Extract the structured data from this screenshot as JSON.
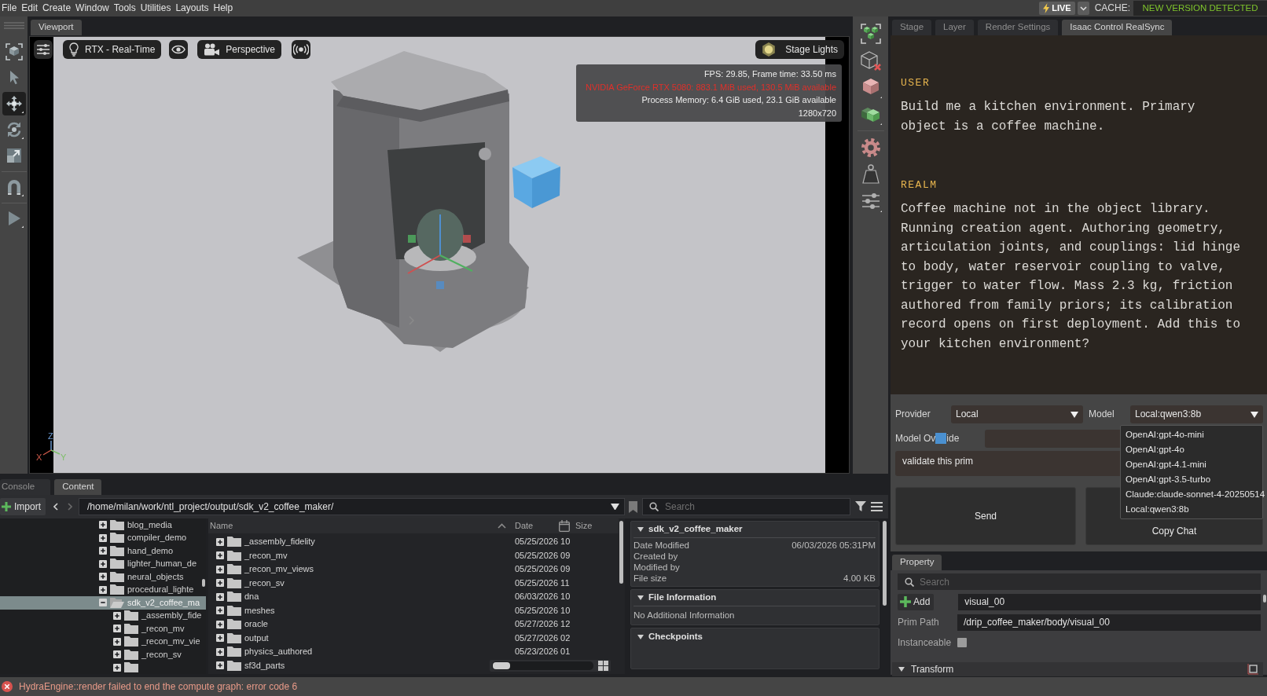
{
  "menu_bar": {
    "items": [
      "File",
      "Edit",
      "Create",
      "Window",
      "Tools",
      "Utilities",
      "Layouts",
      "Help"
    ],
    "live_label": "LIVE",
    "cache_label": "CACHE:",
    "cache_status": "NEW VERSION DETECTED"
  },
  "tool_strip": [
    {
      "kind": "frame",
      "selected": false
    },
    {
      "kind": "select",
      "selected": false
    },
    {
      "kind": "move",
      "selected": true
    },
    {
      "kind": "rotate",
      "selected": false
    },
    {
      "kind": "scale",
      "selected": false
    },
    {
      "kind": "snap",
      "selected": false
    },
    {
      "kind": "play",
      "selected": false
    }
  ],
  "viewport": {
    "tab": "Viewport",
    "renderer": "RTX - Real-Time",
    "camera": "Perspective",
    "lights": "Stage Lights",
    "stats": [
      {
        "text": "FPS: 29.85, Frame time: 33.50 ms",
        "warning": false
      },
      {
        "text": "NVIDIA GeForce RTX 5080: 883.1 MiB used, 130.5 MiB available",
        "warning": true
      },
      {
        "text": "Process Memory: 6.4 GiB used, 23.1 GiB available",
        "warning": false
      },
      {
        "text": "1280x720",
        "warning": false
      }
    ],
    "axes": [
      "Z",
      "X",
      "Y"
    ]
  },
  "side_panel": {
    "tabs": [
      {
        "label": "Stage",
        "selected": false
      },
      {
        "label": "Layer",
        "selected": false
      },
      {
        "label": "Render Settings",
        "selected": false
      },
      {
        "label": "Isaac Control RealSync",
        "selected": true
      }
    ],
    "chat": [
      {
        "speaker": "USER",
        "text": "Build me a kitchen environment. Primary object is a coffee machine."
      },
      {
        "speaker": "REALM",
        "text": "Coffee machine not in the object library. Running creation agent. Authoring geometry, articulation joints, and couplings: lid hinge to body, water reservoir coupling to valve, trigger to water flow. Mass 2.3 kg, friction authored from family priors; its calibration record opens on first deployment. Add this to your kitchen environment?"
      }
    ],
    "provider_label": "Provider",
    "provider": "Local",
    "model_label": "Model",
    "model": "Local:qwen3:8b",
    "model_options": [
      {
        "label": "OpenAI:gpt-4o-mini",
        "selected": false
      },
      {
        "label": "OpenAI:gpt-4o",
        "selected": false
      },
      {
        "label": "OpenAI:gpt-4.1-mini",
        "selected": false
      },
      {
        "label": "OpenAI:gpt-3.5-turbo",
        "selected": false
      },
      {
        "label": "Claude:claude-sonnet-4-20250514",
        "selected": false
      },
      {
        "label": "Local:qwen3:8b",
        "selected": false
      }
    ],
    "override_label_start": "Model Ov",
    "override_label_end": "ide",
    "prompt": "validate this prim",
    "buttons": [
      "Send",
      "Copy Chat"
    ]
  },
  "content": {
    "tabs": [
      {
        "label": "Console",
        "selected": false
      },
      {
        "label": "Content",
        "selected": true
      }
    ],
    "import_label": "Import",
    "path": "/home/milan/work/ntl_project/output/sdk_v2_coffee_maker/",
    "search_placeholder": "Search",
    "tree": [
      {
        "label": "blog_media",
        "expanded": false,
        "selected": false
      },
      {
        "label": "compiler_demo",
        "expanded": false,
        "selected": false
      },
      {
        "label": "hand_demo",
        "expanded": false,
        "selected": false
      },
      {
        "label": "lighter_human_de",
        "expanded": false,
        "selected": false
      },
      {
        "label": "neural_objects",
        "expanded": false,
        "selected": false
      },
      {
        "label": "procedural_lighte",
        "expanded": false,
        "selected": false
      },
      {
        "label": "sdk_v2_coffee_ma",
        "expanded": true,
        "selected": true,
        "children": [
          {
            "label": "_assembly_fide",
            "expanded": false,
            "selected": false
          },
          {
            "label": "_recon_mv",
            "expanded": false,
            "selected": false
          },
          {
            "label": "_recon_mv_vie",
            "expanded": false,
            "selected": false
          },
          {
            "label": "_recon_sv",
            "expanded": false,
            "selected": false
          },
          {
            "expanded": false,
            "selected": false
          }
        ]
      }
    ],
    "columns": [
      "Name",
      "Date",
      "Size"
    ],
    "rows": [
      {
        "name": "_assembly_fidelity",
        "date": "05/25/2026 10",
        "expanded": false
      },
      {
        "name": "_recon_mv",
        "date": "05/25/2026 09",
        "expanded": false
      },
      {
        "name": "_recon_mv_views",
        "date": "05/25/2026 09",
        "expanded": false
      },
      {
        "name": "_recon_sv",
        "date": "05/25/2026 11",
        "expanded": false
      },
      {
        "name": "dna",
        "date": "06/03/2026 10",
        "expanded": false
      },
      {
        "name": "meshes",
        "date": "05/25/2026 10",
        "expanded": false
      },
      {
        "name": "oracle",
        "date": "05/27/2026 12",
        "expanded": false
      },
      {
        "name": "output",
        "date": "05/27/2026 02",
        "expanded": false
      },
      {
        "name": "physics_authored",
        "date": "05/23/2026 01",
        "expanded": false
      },
      {
        "name": "sf3d_parts",
        "expanded": false
      }
    ],
    "details": {
      "title": "sdk_v2_coffee_maker",
      "expanded": true,
      "fields": [
        {
          "label": "Date Modified",
          "value": "06/03/2026 05:31PM"
        },
        {
          "label": "Created by"
        },
        {
          "label": "Modified by"
        },
        {
          "label": "File size",
          "value": "4.00 KB"
        }
      ],
      "sections": [
        {
          "title": "File Information",
          "expanded": true,
          "text": "No Additional Information"
        },
        {
          "title": "Checkpoints",
          "expanded": true
        }
      ]
    }
  },
  "property": {
    "tab": "Property",
    "search_placeholder": "Search",
    "add_label": "Add",
    "name": "visual_00",
    "prim_path_label": "Prim Path",
    "prim_path": "/drip_coffee_maker/body/visual_00",
    "instanceable_label": "Instanceable",
    "instanceable": false,
    "transform": {
      "title": "Transform",
      "expanded": true
    }
  },
  "status_bar": {
    "kind": "error",
    "message": "HydraEngine::render failed to end the compute graph: error code 6"
  }
}
